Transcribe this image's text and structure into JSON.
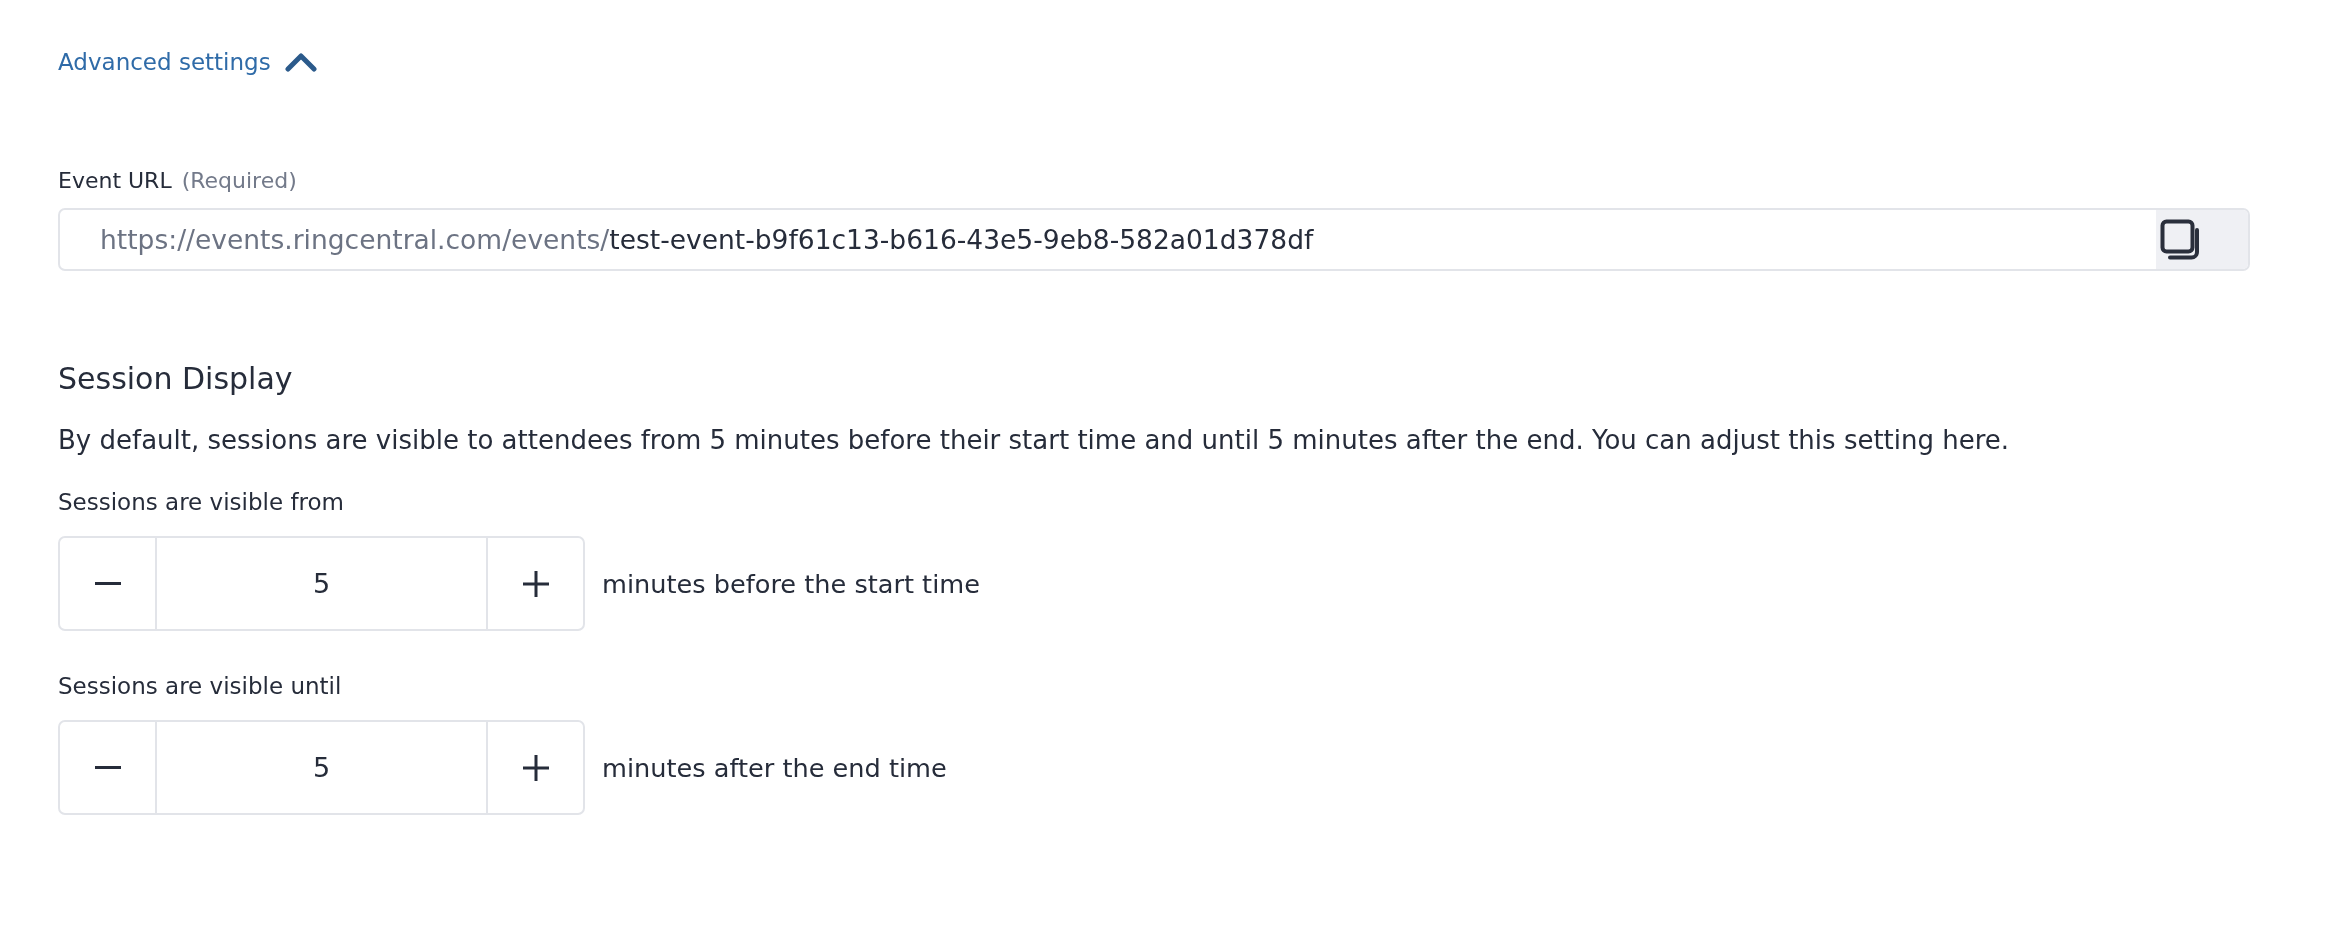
{
  "advanced_settings": {
    "label": "Advanced settings",
    "expanded": true
  },
  "event_url": {
    "label": "Event URL",
    "hint": "(Required)",
    "prefix": "https://events.ringcentral.com/events/",
    "value": "test-event-b9f61c13-b616-43e5-9eb8-582a01d378df"
  },
  "session_display": {
    "title": "Session Display",
    "description": "By default, sessions are visible to attendees from 5 minutes before their start time and until 5 minutes after the end. You can adjust this setting here.",
    "steppers": [
      {
        "label": "Sessions are visible from",
        "value": "5",
        "suffix": "minutes before the start time"
      },
      {
        "label": "Sessions are visible until",
        "value": "5",
        "suffix": "minutes after the end time"
      }
    ]
  }
}
